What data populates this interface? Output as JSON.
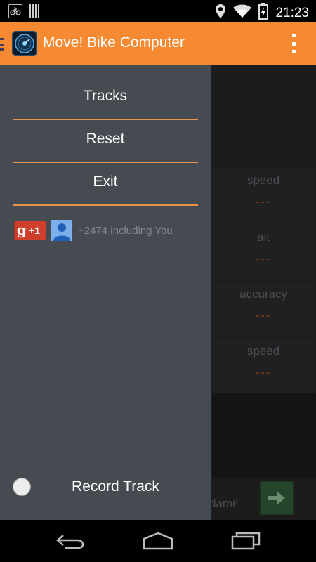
{
  "status_bar": {
    "time": "21:23",
    "icons": [
      "bike-notification-icon",
      "barcode-notification-icon",
      "location-icon",
      "wifi-icon",
      "battery-icon"
    ]
  },
  "action_bar": {
    "title": "Move! Bike Computer",
    "background_color": "#f58a33",
    "icons": [
      "drawer-indicator-icon",
      "app-logo-icon",
      "overflow-menu-icon"
    ]
  },
  "drawer": {
    "items": [
      {
        "label": "Tracks"
      },
      {
        "label": "Reset"
      },
      {
        "label": "Exit"
      }
    ],
    "divider_color": "#e8934c",
    "plus_one": {
      "button_label": "+1",
      "count_text": "+2474 including You"
    },
    "record_track": {
      "label": "Record Track",
      "checked": false
    }
  },
  "content": {
    "cells": [
      {
        "label": "speed",
        "value": "---"
      },
      {
        "label": "alt",
        "value": "---"
      },
      {
        "label": "accuracy",
        "value": "---"
      },
      {
        "label": "speed",
        "value": "---"
      }
    ],
    "ad": {
      "text": "dami!",
      "icon": "arrow-right-icon"
    }
  },
  "nav_bar": {
    "icons": [
      "back-icon",
      "home-icon",
      "recent-apps-icon"
    ]
  }
}
